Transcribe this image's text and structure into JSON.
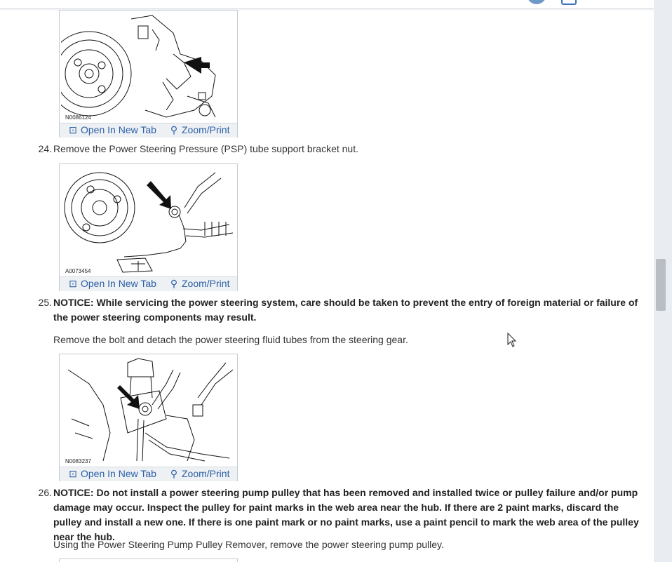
{
  "figures": [
    {
      "code": "N0086124",
      "open_tab_label": "Open In New Tab",
      "zoom_label": "Zoom/Print"
    },
    {
      "code": "A0073454",
      "open_tab_label": "Open In New Tab",
      "zoom_label": "Zoom/Print"
    },
    {
      "code": "N0083237",
      "open_tab_label": "Open In New Tab",
      "zoom_label": "Zoom/Print"
    }
  ],
  "steps": [
    {
      "number": "24.",
      "text": "Remove the Power Steering Pressure (PSP) tube support bracket nut."
    },
    {
      "number": "25.",
      "notice": "NOTICE: While servicing the power steering system, care should be taken to prevent the entry of foreign material or failure of the power steering components may result.",
      "text": "Remove the bolt and detach the power steering fluid tubes from the steering gear."
    },
    {
      "number": "26.",
      "notice_prefix": "NOTICE:",
      "notice_body": " Do not install a power steering pump pulley that has been removed and installed twice or pulley failure and/or pump damage may occur. Inspect the pulley for paint marks in the web area near the hub. If there are 2 paint marks, discard the pulley and install a new one. If there is one paint mark or no paint marks, use a paint pencil to mark the web area of the pulley near the hub.",
      "text": "Using the Power Steering Pump Pulley Remover, remove the power steering pump pulley."
    }
  ],
  "icons": {
    "open_tab": "open-in-new-tab-icon",
    "zoom": "magnifier-icon"
  },
  "colors": {
    "link": "#2b5fa6",
    "action_bar": "#eef1f4"
  }
}
